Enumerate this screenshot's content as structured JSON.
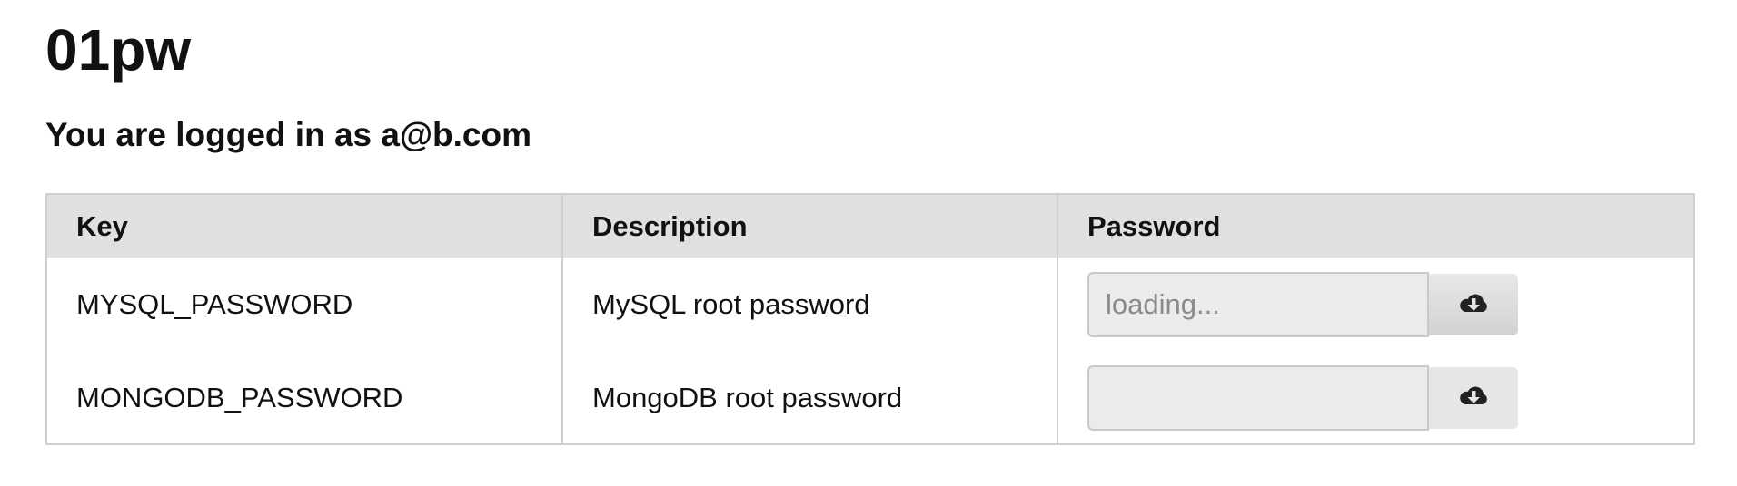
{
  "app": {
    "title": "01pw"
  },
  "session": {
    "status_text": "You are logged in as a@b.com"
  },
  "table": {
    "headers": [
      "Key",
      "Description",
      "Password"
    ],
    "rows": [
      {
        "key": "MYSQL_PASSWORD",
        "description": "MySQL root password",
        "password_value": "",
        "password_placeholder": "loading...",
        "fetch_icon": "cloud-download-icon"
      },
      {
        "key": "MONGODB_PASSWORD",
        "description": "MongoDB root password",
        "password_value": "",
        "password_placeholder": "",
        "fetch_icon": "cloud-download-icon"
      }
    ]
  },
  "colors": {
    "header_bg": "#e0e0e0",
    "border": "#cfcfcf",
    "input_bg": "#ebebeb"
  }
}
